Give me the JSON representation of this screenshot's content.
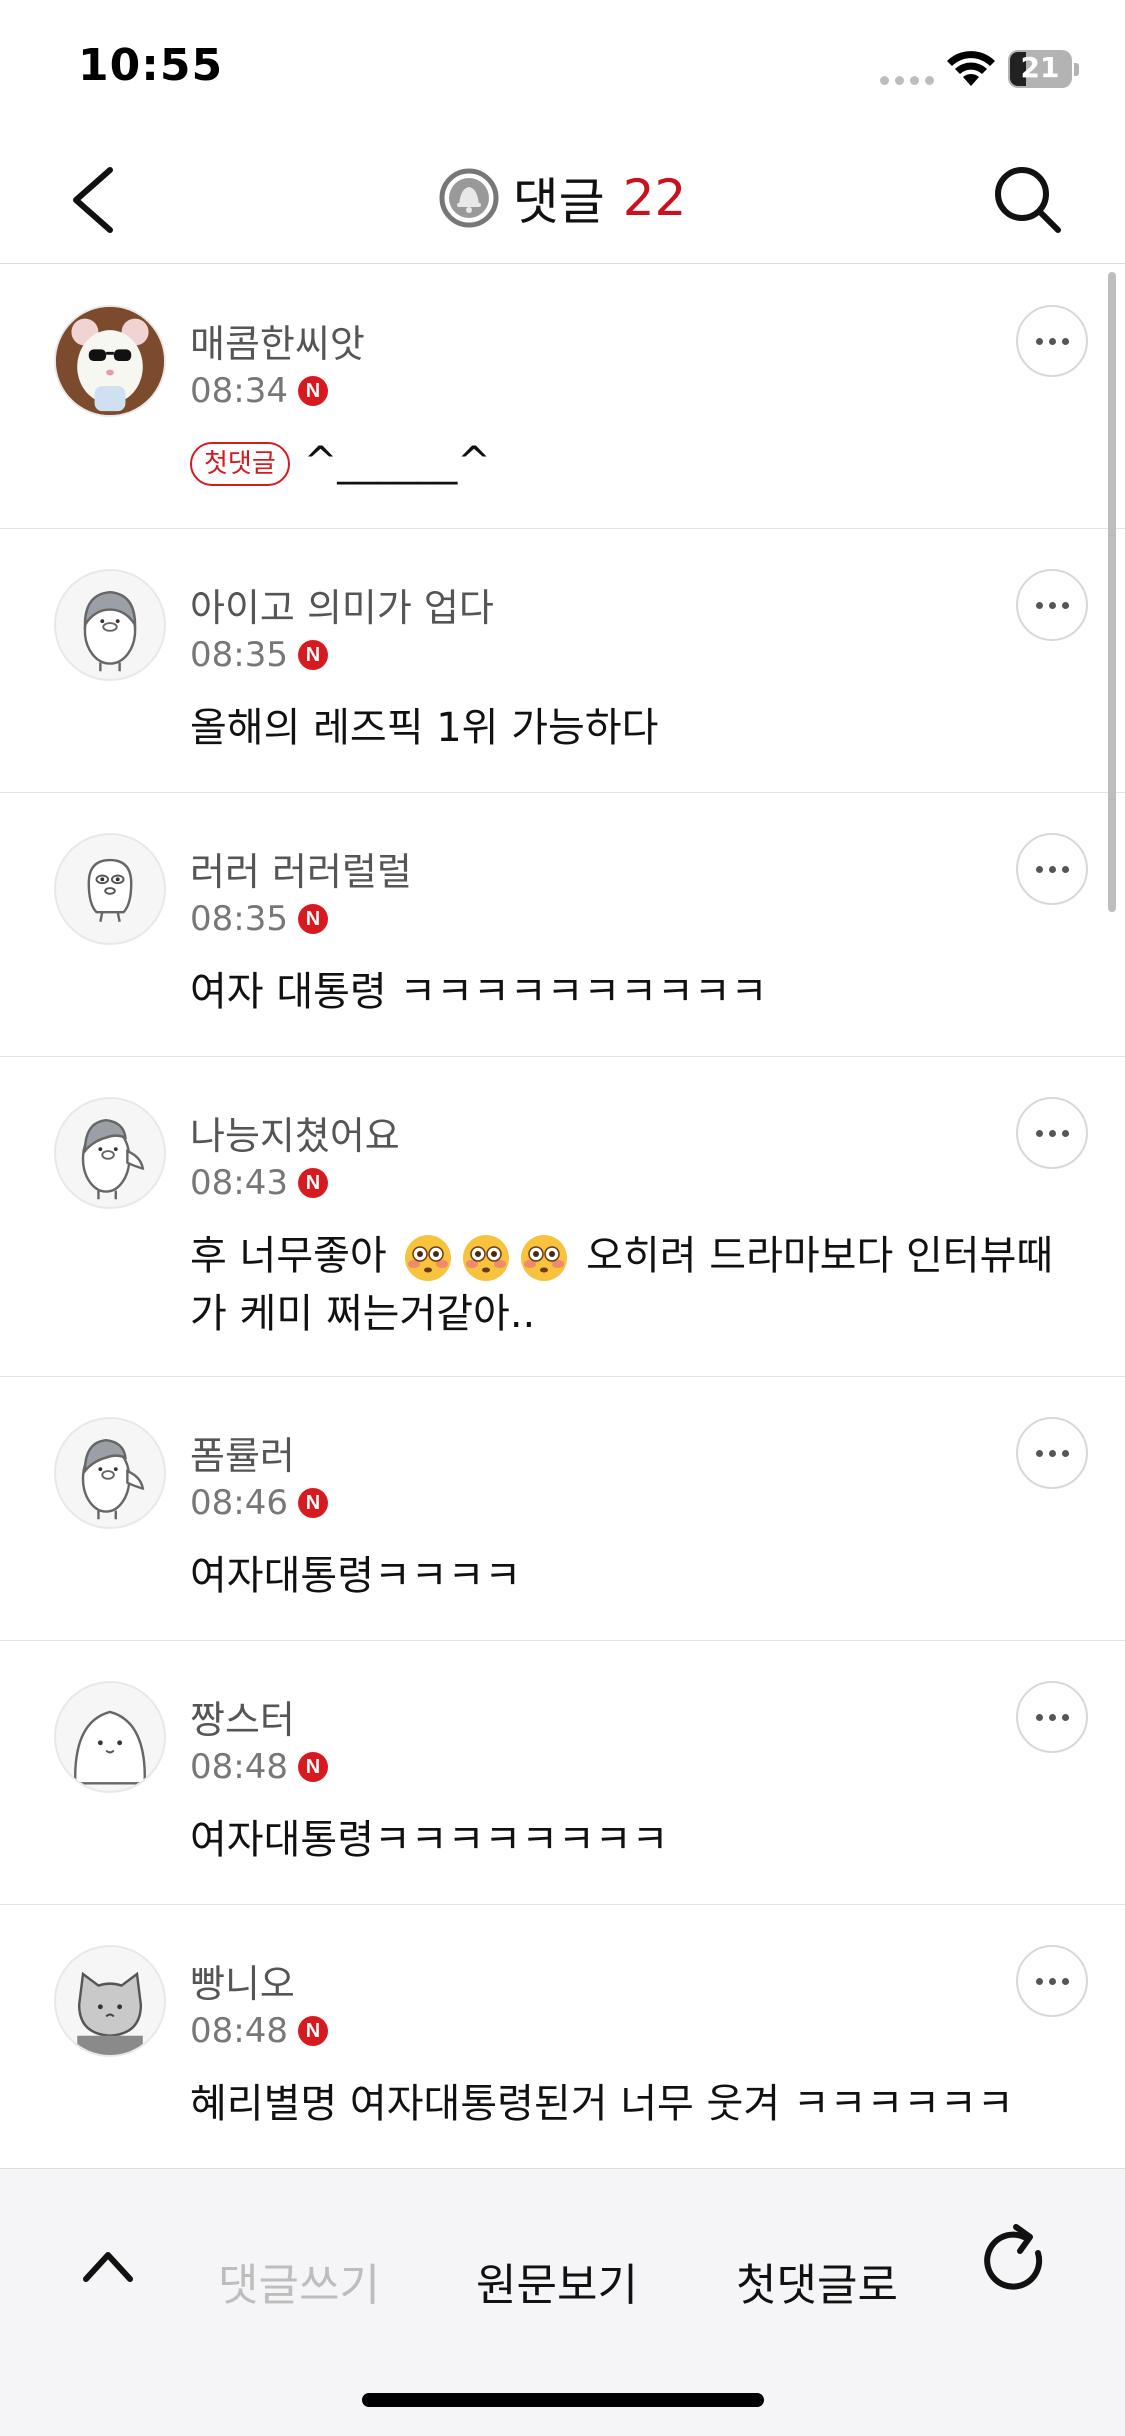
{
  "status_bar": {
    "time": "10:55",
    "battery": "21"
  },
  "header": {
    "title": "댓글",
    "count": "22"
  },
  "comments": [
    {
      "nickname": "매콤한씨앗",
      "time": "08:34",
      "badge": "첫댓글",
      "text": "^______^",
      "avatar": "mouse-sunglasses-avatar"
    },
    {
      "nickname": "아이고 의미가 업다",
      "time": "08:35",
      "text": "올해의 레즈픽 1위 가능하다",
      "avatar": "penguin-avatar"
    },
    {
      "nickname": "러러 러러럴럴",
      "time": "08:35",
      "text": "여자 대통령 ㅋㅋㅋㅋㅋㅋㅋㅋㅋㅋ",
      "avatar": "blob-avatar"
    },
    {
      "nickname": "나능지쳤어요",
      "time": "08:43",
      "text_before": "후 너무좋아",
      "emoji_count": 3,
      "text_after": "오히려 드라마보다 인터뷰때 가 케미 쩌는거같아..",
      "avatar": "penguin-wave-avatar"
    },
    {
      "nickname": "폼률러",
      "time": "08:46",
      "text": "여자대통령ㅋㅋㅋㅋ",
      "avatar": "penguin-wave-avatar"
    },
    {
      "nickname": "짱스터",
      "time": "08:48",
      "text": "여자대통령ㅋㅋㅋㅋㅋㅋㅋㅋ",
      "avatar": "round-face-avatar"
    },
    {
      "nickname": "빵니오",
      "time": "08:48",
      "text": "혜리별명 여자대통령된거 너무 웃겨 ㅋㅋㅋㅋㅋㅋ",
      "avatar": "cat-avatar"
    }
  ],
  "n_badge": "N",
  "bottom_bar": {
    "write": "댓글쓰기",
    "view_original": "원문보기",
    "first_comment": "첫댓글로"
  },
  "colors": {
    "accent_red": "#c8101e",
    "badge_red": "#d71920"
  }
}
